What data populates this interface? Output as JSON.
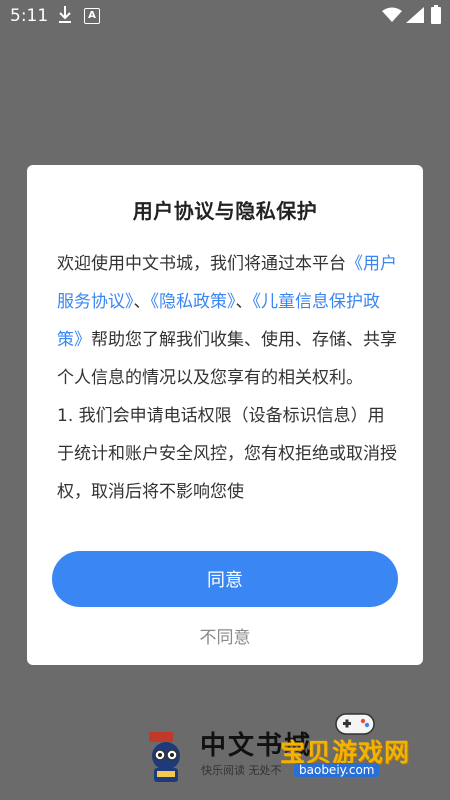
{
  "status_bar": {
    "time": "5:11",
    "app_icon_letter": "A",
    "icons": [
      "download-icon",
      "app-a-icon",
      "wifi-icon",
      "signal-icon",
      "battery-icon"
    ]
  },
  "dialog": {
    "title": "用户协议与隐私保护",
    "intro": "欢迎使用中文书城，我们将通过本平台",
    "link_user_agreement": "《用户服务协议》",
    "sep1": "、",
    "link_privacy_policy": "《隐私政策》",
    "sep2": "、",
    "link_child_privacy": "《儿童信息保护政策》",
    "after_links": "帮助您了解我们收集、使用、存储、共享个人信息的情况以及您享有的相关权利。",
    "item1": " 1. 我们会申请电话权限（设备标识信息）用于统计和账户安全风控，您有权拒绝或取消授权，取消后将不影响您使",
    "agree_label": "同意",
    "disagree_label": "不同意"
  },
  "branding": {
    "app_name": "中文书城",
    "slogan": "快乐阅读 无处不"
  },
  "watermark": {
    "title": "宝贝游戏网",
    "url": "baobeiy.com"
  },
  "colors": {
    "overlay": "#6b6b6b",
    "accent": "#3a86f3",
    "dialog_bg": "#ffffff",
    "disagree_text": "#8a8a8a"
  }
}
